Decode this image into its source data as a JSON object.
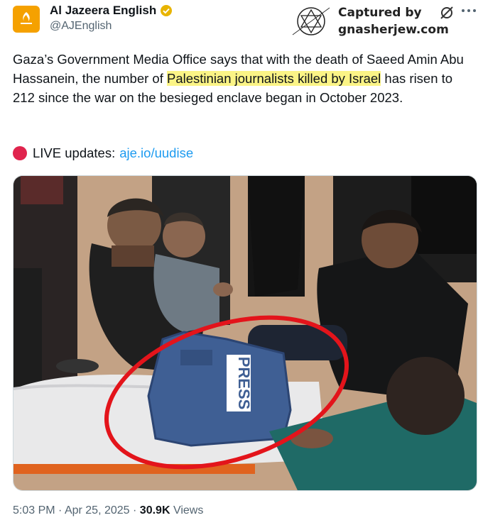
{
  "tweet": {
    "author_name": "Al Jazeera English",
    "handle": "@AJEnglish",
    "text_before": "Gaza’s Government Media Office says that with the death of Saeed Amin Abu Hassanein, the number of ",
    "text_highlight": "Palestinian journalists killed by Israel",
    "text_after": " has risen to 212 since the war on the besieged enclave began in October 2023.",
    "live_label": "LIVE updates:",
    "live_link": "aje.io/uudise",
    "time": "5:03 PM",
    "date": "Apr 25, 2025",
    "views_count": "30.9K",
    "views_label": "Views",
    "dot": "·"
  },
  "watermark": {
    "line1": "Captured by",
    "line2": "gnasherjew.com"
  },
  "media": {
    "vest_text": "PRESS"
  },
  "colors": {
    "link": "#1d9bf0",
    "highlight": "#fbf486",
    "live_dot": "#e0244d",
    "avatar": "#f5a100",
    "verified": "#e8b400",
    "circle": "#e3141b"
  },
  "icons": [
    "verified-badge-icon",
    "grok-icon",
    "more-options-icon",
    "live-dot-icon",
    "star-of-david-icon"
  ]
}
